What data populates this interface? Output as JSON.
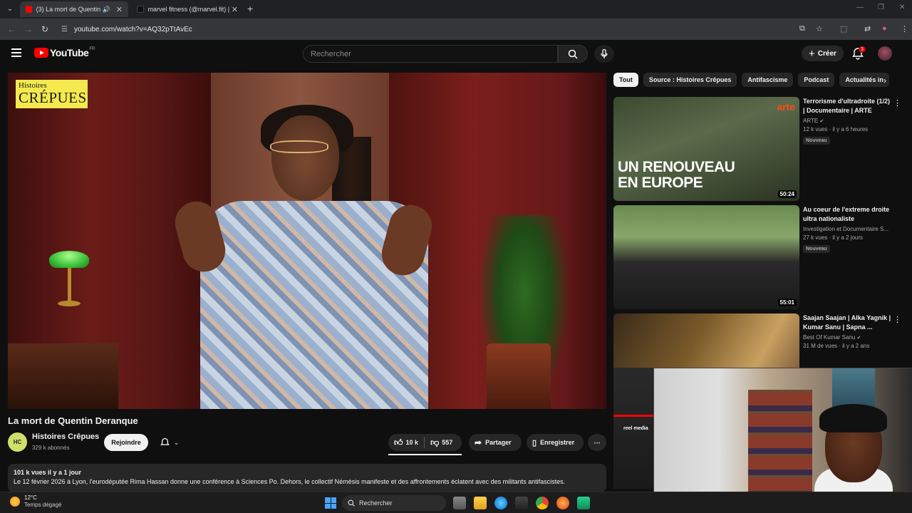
{
  "browser": {
    "tabs": [
      {
        "title": "(3) La mort de Quentin Der",
        "active": true
      },
      {
        "title": "marvel fitness (@marvel.fit) | Ti",
        "active": false
      }
    ],
    "url": "youtube.com/watch?v=AQ32pTtAvEc"
  },
  "header": {
    "logo_text": "YouTube",
    "region": "FR",
    "search_placeholder": "Rechercher",
    "create_label": "Créer",
    "notif_count": "3"
  },
  "player": {
    "logo_line1": "Histoires",
    "logo_line2": "CRÉPUES"
  },
  "video": {
    "title": "La mort de Quentin Deranque",
    "channel": "Histoires Crêpues",
    "subscribers": "329 k abonnés",
    "join_label": "Rejoindre",
    "likes": "10 k",
    "dislikes": "557",
    "share_label": "Partager",
    "save_label": "Enregistrer",
    "description_meta": "101 k vues  il y a 1 jour",
    "description_text": "Le 12 février 2026 à Lyon, l'eurodéputée Rima Hassan donne une conférence à Sciences Po. Dehors, le collectif Némésis manifeste et des affrontements éclatent avec des militants antifascistes."
  },
  "chips": [
    "Tout",
    "Source : Histoires Crêpues",
    "Antifascisme",
    "Podcast",
    "Actualités in"
  ],
  "recommendations": [
    {
      "title": "Terrorisme d'ultradroite (1/2) | Documentaire | ARTE",
      "channel": "ARTE",
      "meta": "12 k vues · il y a 6 heures",
      "badge": "Nouveau",
      "duration": "50:24",
      "thumb_text_1": "UN RENOUVEAU",
      "thumb_text_2": "EN EUROPE",
      "thumb_logo": "arte"
    },
    {
      "title": "Au coeur de l'extreme droite ultra nationaliste",
      "channel": "Investigation et Documentaire S...",
      "meta": "27 k vues · il y a 2 jours",
      "badge": "Nouveau",
      "duration": "55:01"
    },
    {
      "title": "Saajan Saajan | Alka Yagnik | Kumar Sanu | Sapna ...",
      "channel": "Best Of Kumar Sanu",
      "meta": "31 M de vues · il y a 2 ans"
    }
  ],
  "side_thumb_label": "reel media",
  "taskbar": {
    "temp": "12°C",
    "condition": "Temps dégagé",
    "search_label": "Rechercher"
  }
}
